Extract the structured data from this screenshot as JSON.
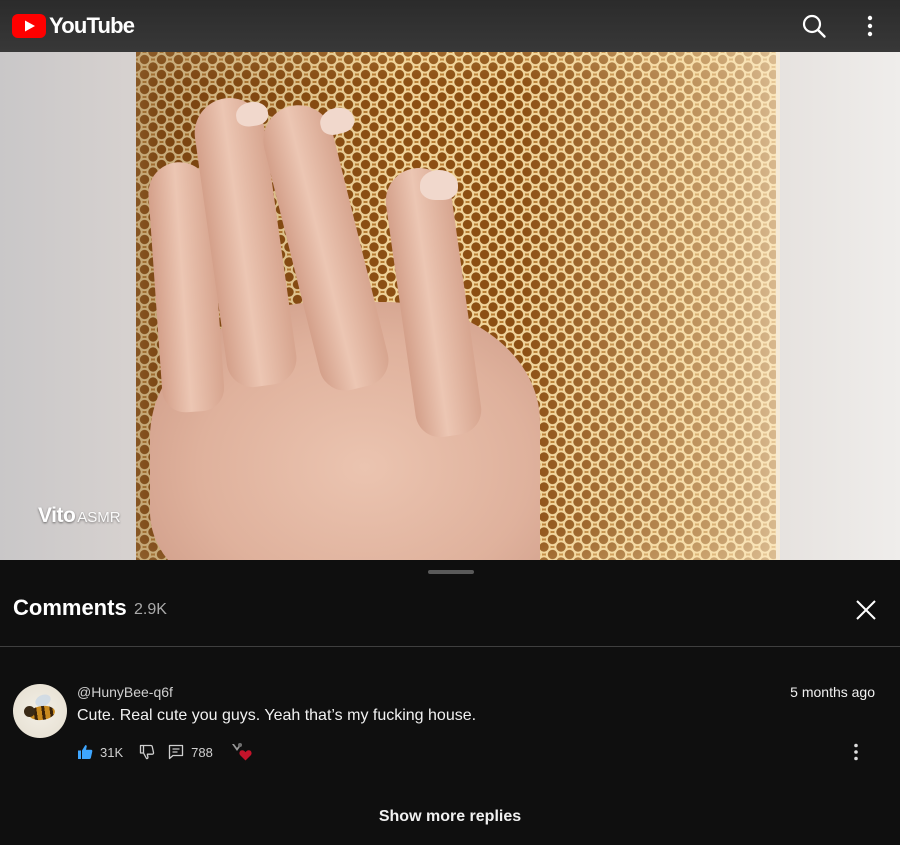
{
  "app": {
    "logo_text": "YouTube",
    "brand_color": "#FF0000"
  },
  "topbar": {
    "search_icon": "search-icon",
    "menu_icon": "more-vertical-icon"
  },
  "video": {
    "watermark_brand": "Vito",
    "watermark_sub": "ASMR"
  },
  "comments": {
    "title": "Comments",
    "count": "2.9K",
    "close_icon": "close-icon",
    "items": [
      {
        "author": "@HunyBee-q6f",
        "time": "5 months ago",
        "text": "Cute. Real cute you guys. Yeah that’s my fucking house.",
        "likes": "31K",
        "replies": "788",
        "liked": true,
        "creator_heart": true
      }
    ],
    "show_more_label": "Show more replies"
  },
  "colors": {
    "background": "#0F0F0F",
    "like_active": "#3EA6FF",
    "heart": "#C4132A"
  }
}
